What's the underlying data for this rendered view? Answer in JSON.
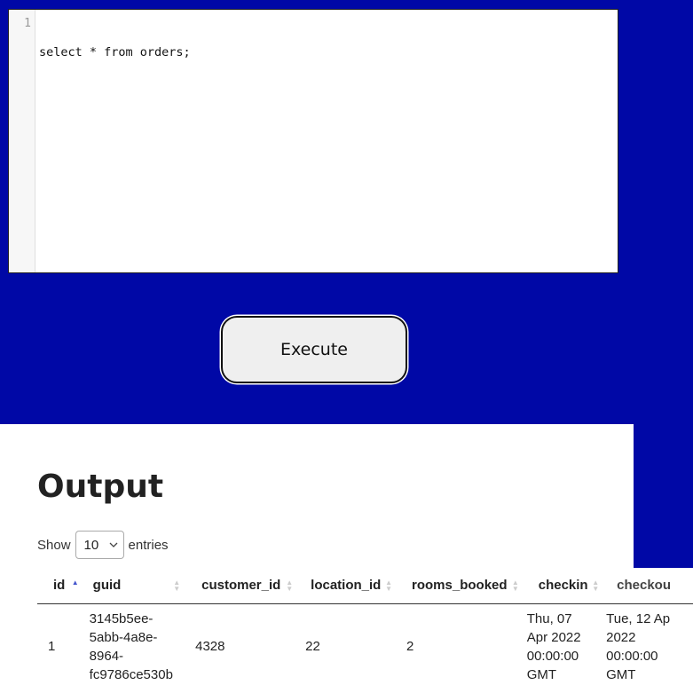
{
  "editor": {
    "line_numbers": [
      "1"
    ],
    "code_lines": [
      "select * from orders;"
    ]
  },
  "execute_button": {
    "label": "Execute"
  },
  "output": {
    "heading": "Output",
    "show_label": "Show",
    "entries_value": "10",
    "entries_label": "entries",
    "sort": {
      "column": "id",
      "direction": "ascending"
    },
    "columns": [
      "id",
      "guid",
      "customer_id",
      "location_id",
      "rooms_booked",
      "checkin",
      "checkou"
    ],
    "rows": [
      {
        "id": "1",
        "guid": [
          "3145b5ee-",
          "5abb-4a8e-",
          "8964-",
          "fc9786ce530b"
        ],
        "customer_id": "4328",
        "location_id": "22",
        "rooms_booked": "2",
        "checkin": [
          "Thu, 07",
          "Apr 2022",
          "00:00:00",
          "GMT"
        ],
        "checkout": [
          "Tue, 12 Ap",
          "2022",
          "00:00:00",
          "GMT"
        ]
      }
    ]
  },
  "colors": {
    "page_background": "#0008a6",
    "sort_active": "#4455cc"
  }
}
